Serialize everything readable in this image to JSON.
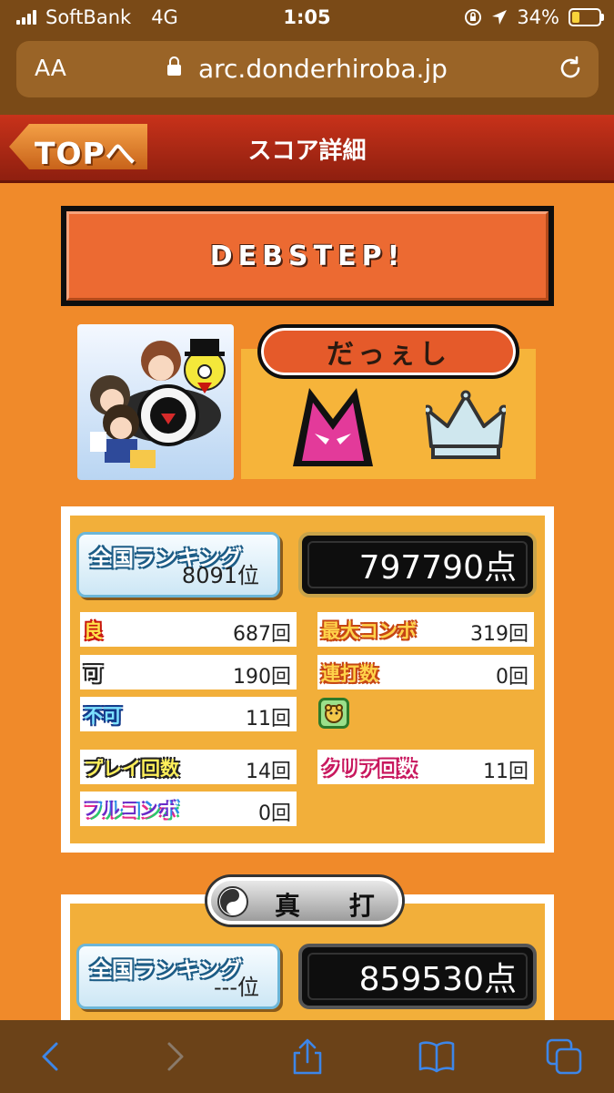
{
  "status_bar": {
    "carrier": "SoftBank",
    "network": "4G",
    "time": "1:05",
    "battery": "34%"
  },
  "address_bar": {
    "text_size_label": "AA",
    "url": "arc.donderhiroba.jp"
  },
  "header": {
    "back_label": "TOPへ",
    "title": "スコア詳細"
  },
  "song": {
    "title": "DEBSTEP!"
  },
  "difficulty": {
    "name": "だっぇし",
    "level_icon": "oni-icon",
    "crown_icon": "crown-icon"
  },
  "score": {
    "ranking_label": "全国ランキング",
    "rank": "8091位",
    "points": "797790点",
    "stats_left": [
      {
        "key": "良",
        "value": "687回"
      },
      {
        "key": "可",
        "value": "190回"
      },
      {
        "key": "不可",
        "value": "11回"
      }
    ],
    "stats_right": [
      {
        "key": "最大コンボ",
        "value": "319回"
      },
      {
        "key": "連打数",
        "value": "0回"
      }
    ],
    "play_count": {
      "key": "プレイ回数",
      "value": "14回"
    },
    "clear_count": {
      "key": "クリア回数",
      "value": "11回"
    },
    "full_combo": {
      "key": "フルコンボ",
      "value": "0回"
    }
  },
  "shinuchi": {
    "label": "真 打",
    "ranking_label": "全国ランキング",
    "rank": "---位",
    "points": "859530点"
  }
}
